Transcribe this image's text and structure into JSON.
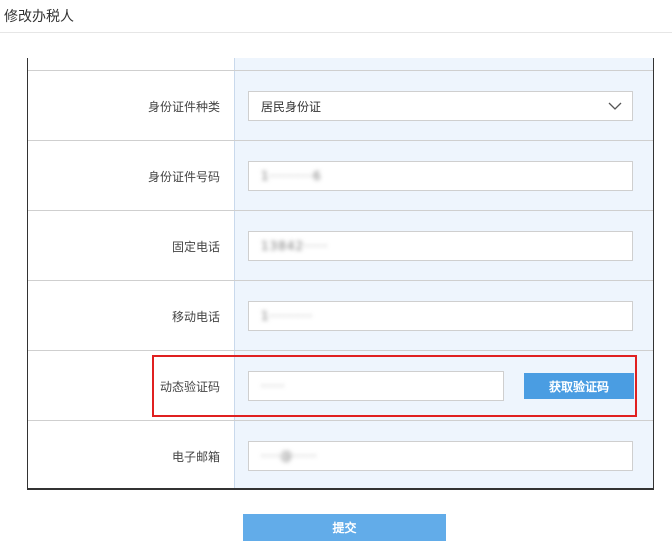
{
  "page": {
    "title": "修改办税人"
  },
  "form": {
    "id_type": {
      "label": "身份证件种类",
      "value": "居民身份证"
    },
    "id_number": {
      "label": "身份证件号码",
      "value": "1·········6"
    },
    "landline": {
      "label": "固定电话",
      "value": "13842·····"
    },
    "mobile": {
      "label": "移动电话",
      "value": "1·········"
    },
    "verify_code": {
      "label": "动态验证码",
      "value": "·····",
      "button_label": "获取验证码"
    },
    "email": {
      "label": "电子邮箱",
      "value": "····@·····"
    }
  },
  "actions": {
    "submit_label": "提交"
  },
  "colors": {
    "accent": "#4a9de2",
    "highlight": "#e02020",
    "input_panel": "#eef5fd"
  }
}
